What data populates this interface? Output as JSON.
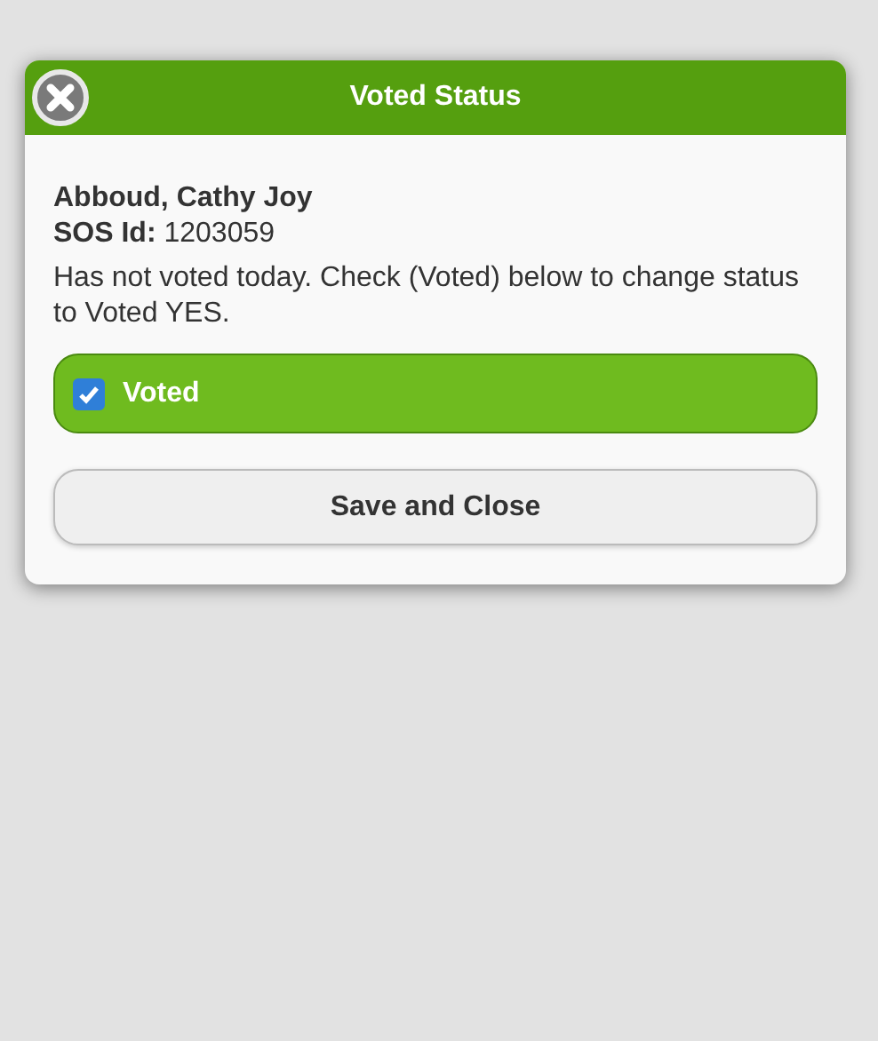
{
  "dialog": {
    "title": "Voted Status",
    "voter_name": "Abboud, Cathy Joy",
    "sos_id": "**SOS Id:** 1203059",
    "message": "Has not voted today. Check (Voted) below to change status to Voted YES.",
    "voted_option": {
      "label": "Voted",
      "checked": true
    },
    "buttons": [
      {
        "label": "Save and Close"
      }
    ]
  }
}
